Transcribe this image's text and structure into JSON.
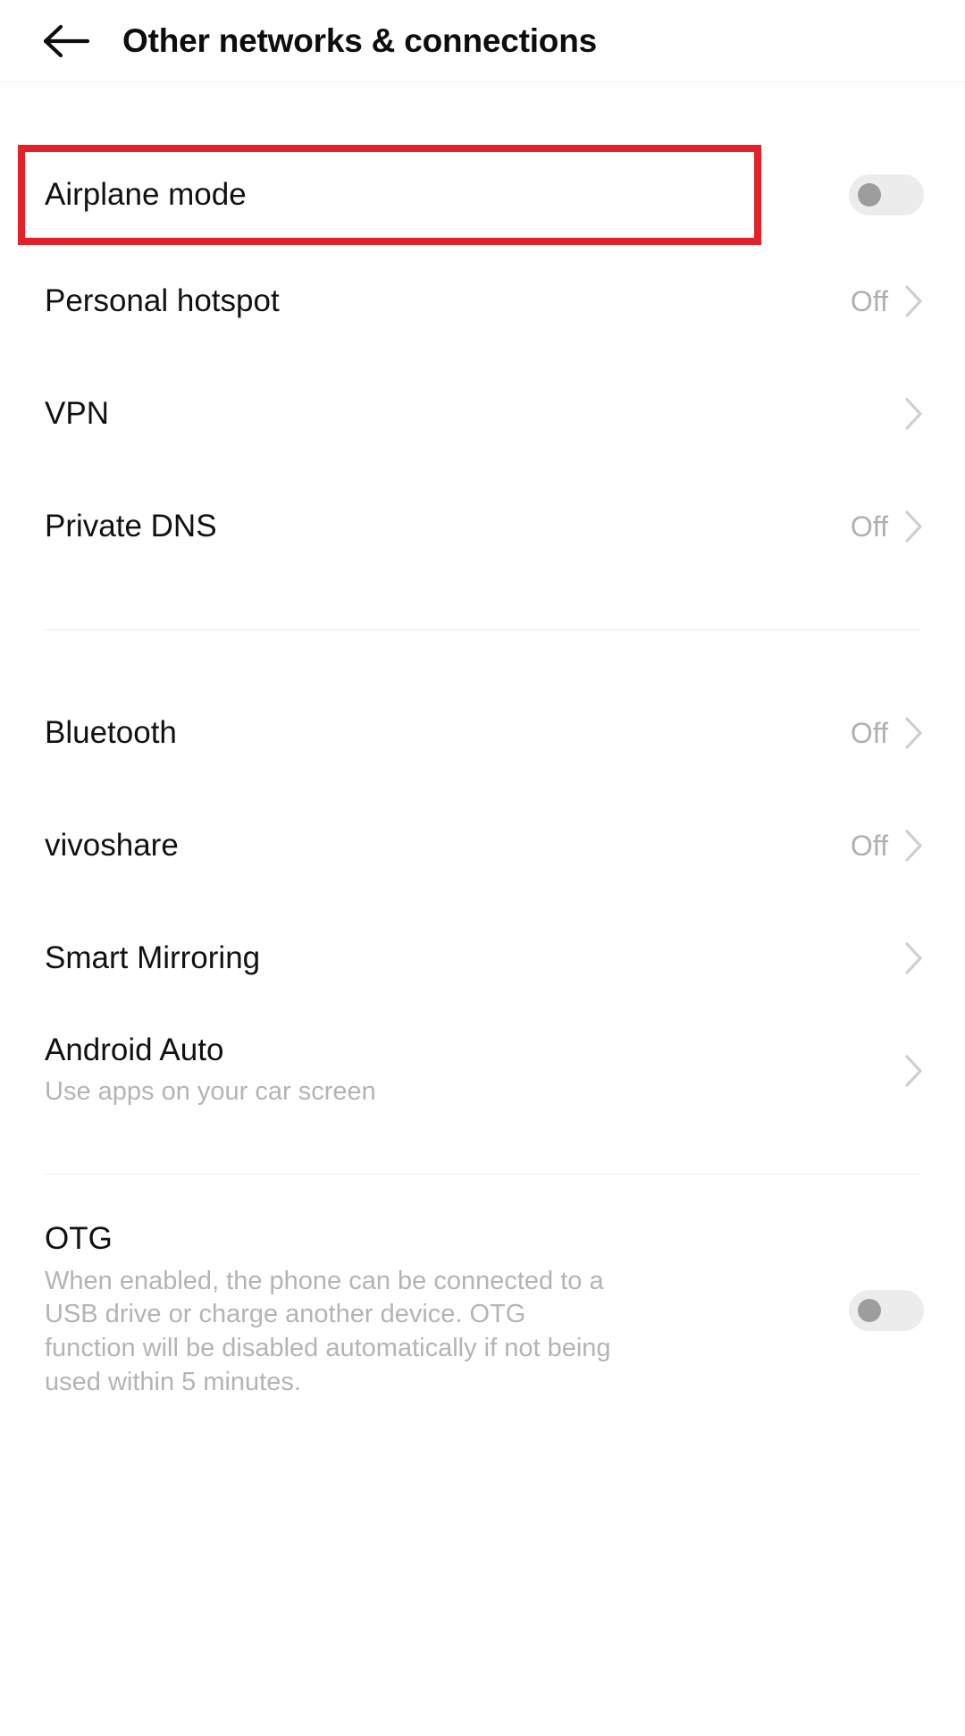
{
  "header": {
    "back_icon": "back-arrow-icon",
    "title": "Other networks & connections"
  },
  "highlight": {
    "color": "#e32128",
    "target": "Airplane mode"
  },
  "colors": {
    "accent_red": "#e32128",
    "title_text": "#111111",
    "secondary_text": "#b4b4b4",
    "value_text": "#b0b0b0",
    "divider": "#ededed",
    "toggle_track_off": "#ececec",
    "toggle_knob_off": "#9d9d9d"
  },
  "sections": [
    {
      "rows": [
        {
          "title": "Airplane mode",
          "subtitle": "",
          "value": "",
          "control": "toggle",
          "toggle_state": "off",
          "chevron": false,
          "highlighted": true
        },
        {
          "title": "Personal hotspot",
          "subtitle": "",
          "value": "Off",
          "control": "chevron",
          "chevron": true,
          "highlighted": false
        },
        {
          "title": "VPN",
          "subtitle": "",
          "value": "",
          "control": "chevron",
          "chevron": true,
          "highlighted": false
        },
        {
          "title": "Private DNS",
          "subtitle": "",
          "value": "Off",
          "control": "chevron",
          "chevron": true,
          "highlighted": false
        }
      ]
    },
    {
      "rows": [
        {
          "title": "Bluetooth",
          "subtitle": "",
          "value": "Off",
          "control": "chevron",
          "chevron": true,
          "highlighted": false
        },
        {
          "title": "vivoshare",
          "subtitle": "",
          "value": "Off",
          "control": "chevron",
          "chevron": true,
          "highlighted": false
        },
        {
          "title": "Smart Mirroring",
          "subtitle": "",
          "value": "",
          "control": "chevron",
          "chevron": true,
          "highlighted": false
        },
        {
          "title": "Android Auto",
          "subtitle": "Use apps on your car screen",
          "value": "",
          "control": "chevron",
          "chevron": true,
          "highlighted": false
        }
      ]
    },
    {
      "rows": [
        {
          "title": "OTG",
          "subtitle": "When enabled, the phone can be connected to a USB drive or charge another device. OTG function will be disabled automatically if not being used within 5 minutes.",
          "value": "",
          "control": "toggle",
          "toggle_state": "off",
          "chevron": false,
          "highlighted": false
        }
      ]
    }
  ]
}
